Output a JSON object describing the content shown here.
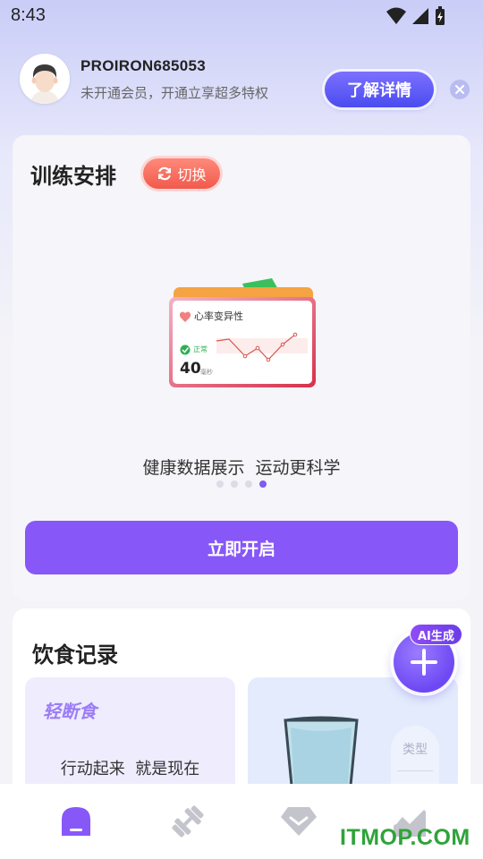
{
  "status_bar": {
    "time": "8:43"
  },
  "profile": {
    "username": "PROIRON685053",
    "member_tip": "未开通会员，开通立享超多特权",
    "detail_label": "了解详情"
  },
  "training": {
    "title": "训练安排",
    "switch_label": "切换",
    "card": {
      "title": "心率变异性",
      "status": "正常",
      "value": "40",
      "unit": "毫秒"
    },
    "slogan": "健康数据展示  运动更科学",
    "carousel": {
      "total": 4,
      "active_index": 3
    },
    "start_label": "立即开启"
  },
  "diet": {
    "title": "饮食记录",
    "fasting_title": "轻断食",
    "fasting_subtitle": "行动起来  就是现在",
    "type_label": "类型",
    "ai_badge": "AI生成"
  },
  "tabs": [
    {
      "icon": "home-icon",
      "active": true
    },
    {
      "icon": "dumbbell-icon",
      "active": false
    },
    {
      "icon": "diamond-icon",
      "active": false
    },
    {
      "icon": "chart-icon",
      "active": false
    }
  ],
  "watermark": "ITMOP.COM",
  "colors": {
    "accent": "#8757f8",
    "switch": "#f05a4c",
    "detail": "#4a4cf0"
  }
}
